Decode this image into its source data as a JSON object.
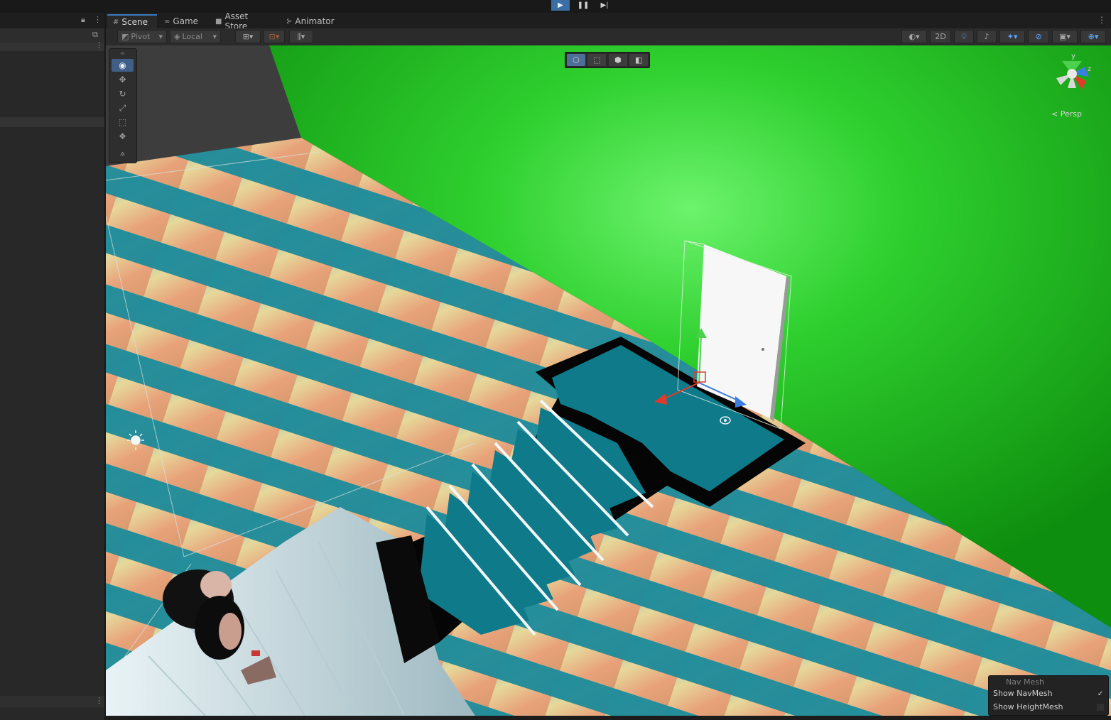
{
  "playbar": {
    "play_icon": "play-icon",
    "pause_icon": "pause-icon",
    "step_icon": "step-icon"
  },
  "tabs": [
    {
      "label": "Scene",
      "icon": "grid-icon",
      "active": true
    },
    {
      "label": "Game",
      "icon": "gamepad-icon",
      "active": false
    },
    {
      "label": "Asset Store",
      "icon": "bag-icon",
      "active": false
    },
    {
      "label": "Animator",
      "icon": "animator-icon",
      "active": false
    }
  ],
  "toolbar": {
    "pivot_label": "Pivot",
    "local_label": "Local",
    "mode_2d_label": "2D"
  },
  "gizmo": {
    "projection_label": "< Persp",
    "axis_y": "y",
    "axis_z": "z"
  },
  "navmesh_overlay": {
    "title": "Nav Mesh",
    "items": [
      {
        "label": "Show NavMesh",
        "checked": true
      },
      {
        "label": "Show HeightMesh",
        "checked": false
      }
    ]
  },
  "colors": {
    "accent": "#3a79bb",
    "wall_green": "#1fbf1f",
    "navmesh_teal": "#0e7a8a",
    "floor_yellow": "#e6e07a",
    "floor_salmon": "#e8a27a"
  }
}
